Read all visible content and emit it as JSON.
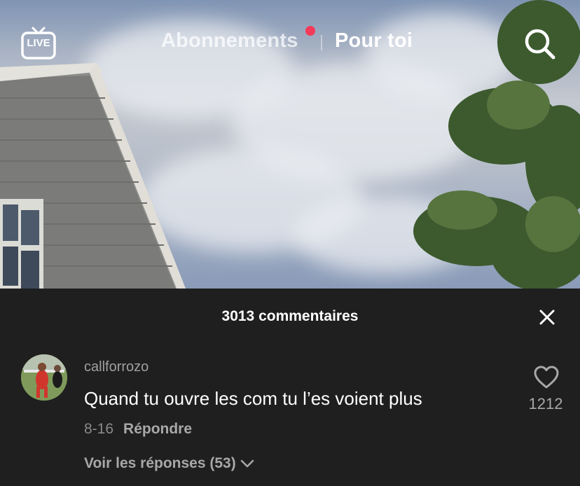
{
  "topbar": {
    "live_label": "LIVE",
    "tabs": [
      {
        "label": "Abonnements",
        "active": false,
        "has_notification_dot": true
      },
      {
        "label": "Pour toi",
        "active": true
      }
    ],
    "search_icon": "search-icon",
    "notification_dot_color": "#f5395a"
  },
  "comments_sheet": {
    "title": "3013 commentaires",
    "close_icon": "close-icon",
    "comments": [
      {
        "username": "callforrozo",
        "text": "Quand tu ouvre les com tu l’es voient plus",
        "date": "8-16",
        "reply_label": "Répondre",
        "likes": "1212",
        "view_replies_label": "Voir les réponses (53)"
      }
    ]
  }
}
